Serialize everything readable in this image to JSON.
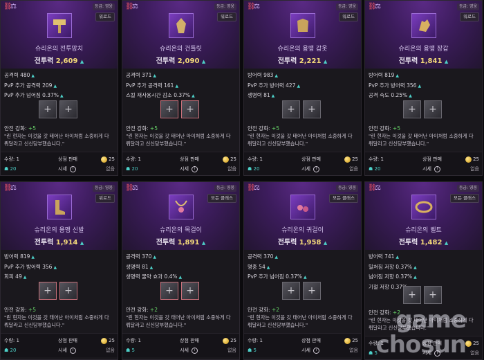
{
  "shared": {
    "grade_label": "등급: 영웅",
    "safe_label": "안전 강화:",
    "description": "\"린 현자는 이것을 갓 태어난 아이처럼 소중하게 다 뤄달라고 신신당부했습니다.\"",
    "qty_label": "수량: 1",
    "shop_label": "상점 판매",
    "gold": "25",
    "market_label": "시세",
    "market_value": "없음",
    "power_label": "전투력"
  },
  "items": [
    {
      "name": "슈리온의 전투망치",
      "class": "워로드",
      "power": "2,609",
      "icon": "hammer-icon",
      "stats": [
        "공격력 480",
        "PvP 추가 공격력 209",
        "PvP 추가 넘어짐 0.37%"
      ],
      "safe": "+5",
      "bag": "20",
      "pink_sockets": false
    },
    {
      "name": "슈리온의 건틀릿",
      "class": "워로드",
      "power": "2,090",
      "icon": "gauntlet-icon",
      "stats": [
        "공격력 371",
        "PvP 추가 공격력 161",
        "스킬 재사용시간 감소 0.37%"
      ],
      "safe": "+5",
      "bag": "20",
      "pink_sockets": true
    },
    {
      "name": "슈리온의 용맹 갑옷",
      "class": "워로드",
      "power": "2,221",
      "icon": "armor-icon",
      "stats": [
        "방어력 983",
        "PvP 추가 방어력 427",
        "생명력 81"
      ],
      "safe": "+5",
      "bag": "20",
      "pink_sockets": false
    },
    {
      "name": "슈리온의 용맹 장갑",
      "class": "워로드",
      "power": "1,841",
      "icon": "gloves-icon",
      "stats": [
        "방어력 819",
        "PvP 추가 방어력 356",
        "공격 속도 0.25%"
      ],
      "safe": "+5",
      "bag": "20",
      "pink_sockets": false
    },
    {
      "name": "슈리온의 용맹 신발",
      "class": "워로드",
      "power": "1,914",
      "icon": "boots-icon",
      "stats": [
        "방어력 819",
        "PvP 추가 방어력 356",
        "회피 49"
      ],
      "safe": "+5",
      "bag": "20",
      "pink_sockets": true
    },
    {
      "name": "슈리온의 목걸이",
      "class": "모든 클래스",
      "power": "1,891",
      "icon": "necklace-icon",
      "stats": [
        "공격력 370",
        "생명력 81",
        "생명력 물약 효과 0.4%"
      ],
      "safe": "+2",
      "bag": "5",
      "pink_sockets": true
    },
    {
      "name": "슈리온의 귀걸이",
      "class": "모든 클래스",
      "power": "1,958",
      "icon": "earring-icon",
      "stats": [
        "공격력 370",
        "명중 54",
        "PvP 추가 넘어짐 0.37%"
      ],
      "safe": "+2",
      "bag": "5",
      "pink_sockets": false
    },
    {
      "name": "슈리온의 벨트",
      "class": "모든 클래스",
      "power": "1,482",
      "icon": "belt-icon",
      "stats": [
        "방어력 741",
        "밀쳐짐 저항 0.37%",
        "넘어짐 저항 0.37%",
        "기절 저항 0.37%"
      ],
      "safe": "+2",
      "bag": "5",
      "pink_sockets": false
    }
  ],
  "watermark": "game chosun"
}
